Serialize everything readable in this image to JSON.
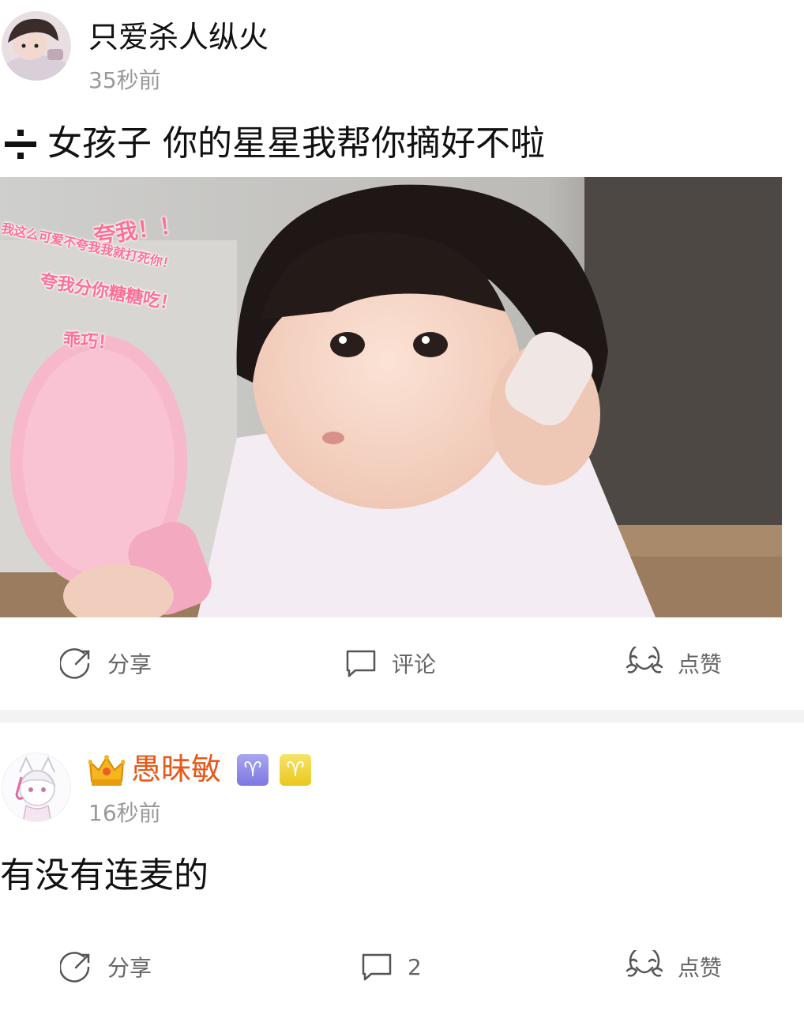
{
  "post1": {
    "username": "只爱杀人纵火",
    "time": "35秒前",
    "content": "女孩子 你的星星我帮你摘好不啦",
    "image_stickers": [
      "夸我！！",
      "我这么可爱不夸我我就打死你！",
      "夸我分你糖糖吃！",
      "乖巧！"
    ],
    "actions": {
      "share": "分享",
      "comment": "评论",
      "like": "点赞"
    }
  },
  "post2": {
    "username": "愚昧敏",
    "username_color": "#e8581a",
    "time": "16秒前",
    "content": "有没有连麦的",
    "zodiac_symbol": "♈",
    "actions": {
      "share": "分享",
      "comment_count": "2",
      "like": "点赞"
    }
  }
}
